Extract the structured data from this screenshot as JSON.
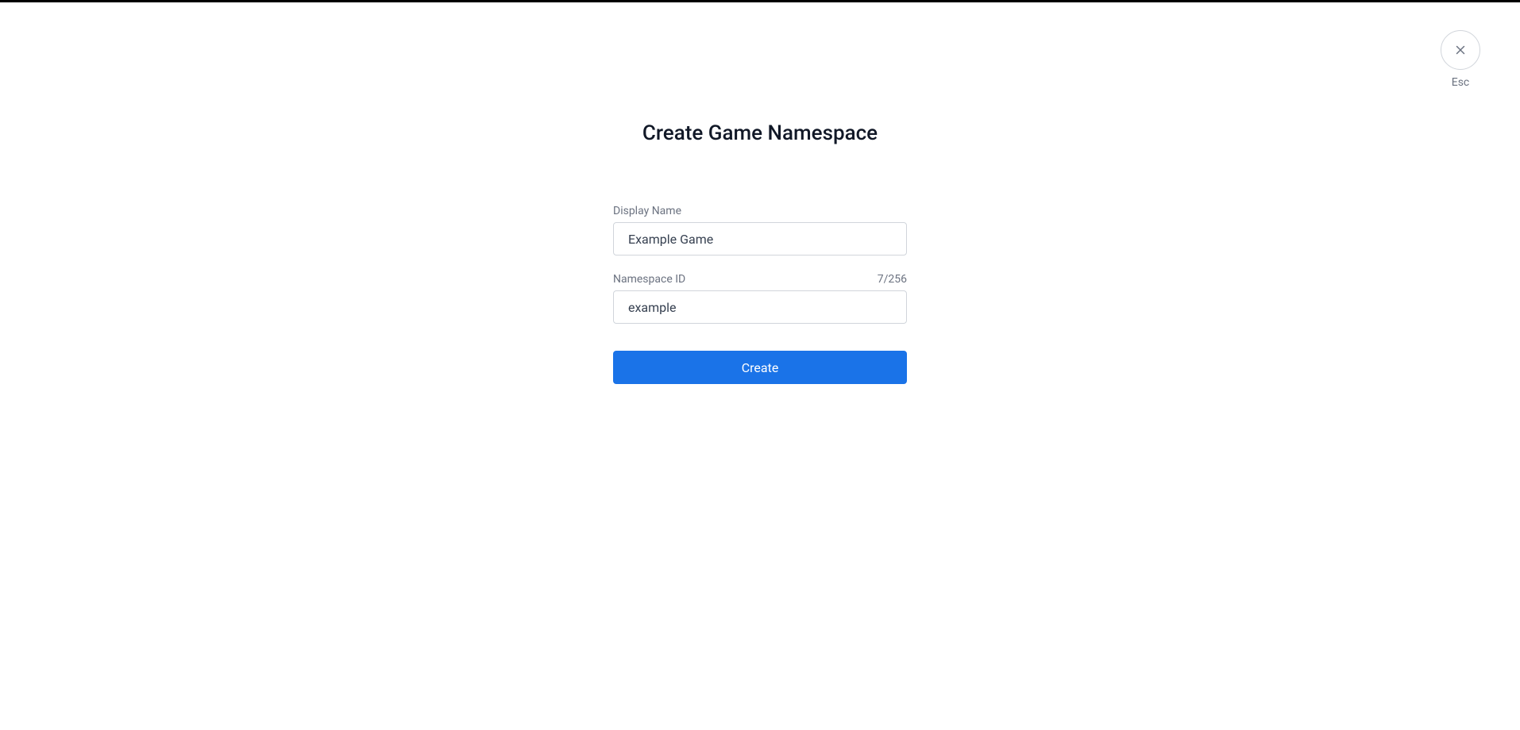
{
  "modal": {
    "title": "Create Game Namespace",
    "close_hint": "Esc"
  },
  "form": {
    "display_name": {
      "label": "Display Name",
      "value": "Example Game"
    },
    "namespace_id": {
      "label": "Namespace ID",
      "counter": "7/256",
      "value": "example"
    },
    "submit_label": "Create"
  }
}
